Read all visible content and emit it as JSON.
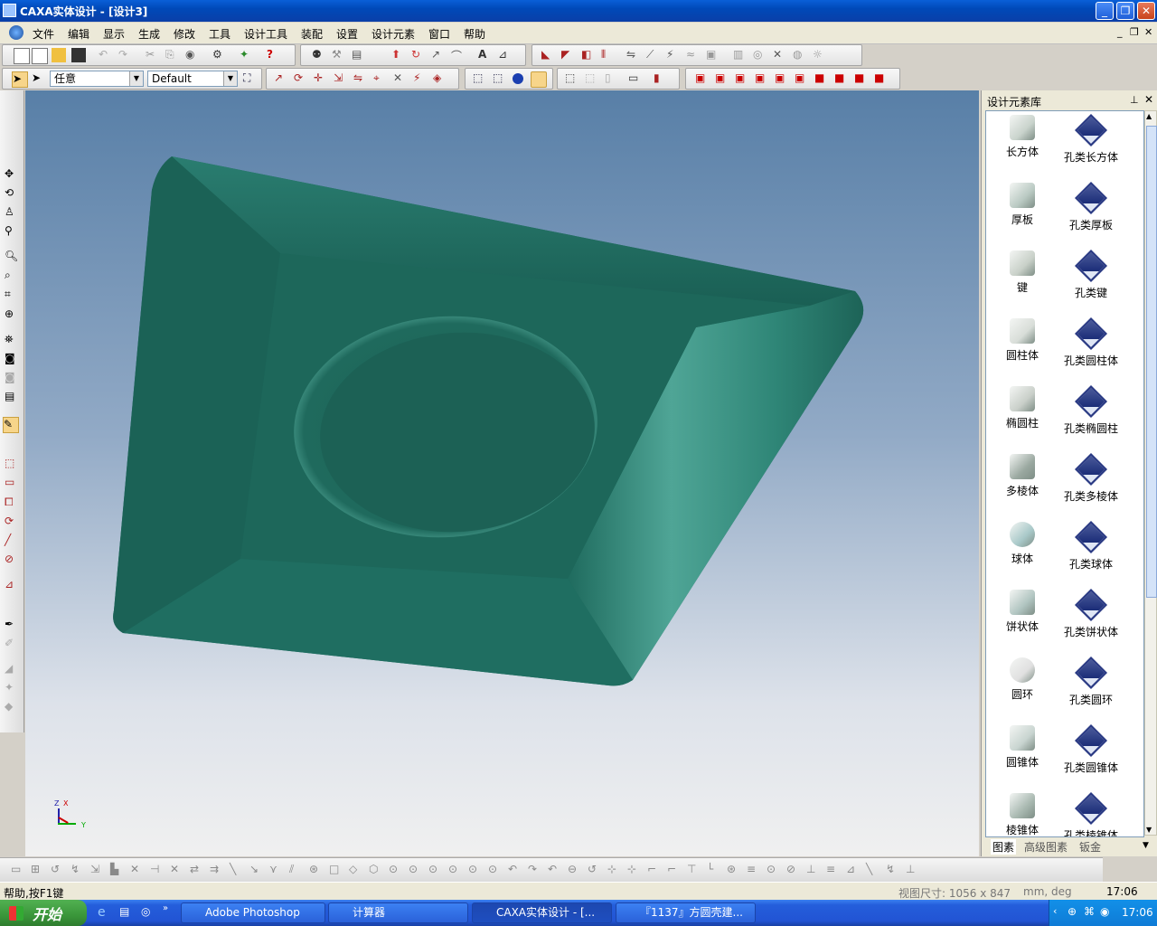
{
  "window": {
    "title": "CAXA实体设计 - [设计3]"
  },
  "menu": [
    "文件",
    "编辑",
    "显示",
    "生成",
    "修改",
    "工具",
    "设计工具",
    "装配",
    "设置",
    "设计元素",
    "窗口",
    "帮助"
  ],
  "toolbar": {
    "select_mode": "任意",
    "style": "Default"
  },
  "panel": {
    "title": "设计元素库",
    "items": [
      {
        "label": "长方体",
        "hole_label": "孔类长方体"
      },
      {
        "label": "厚板",
        "hole_label": "孔类厚板"
      },
      {
        "label": "键",
        "hole_label": "孔类键"
      },
      {
        "label": "圆柱体",
        "hole_label": "孔类圆柱体"
      },
      {
        "label": "椭圆柱",
        "hole_label": "孔类椭圆柱"
      },
      {
        "label": "多棱体",
        "hole_label": "孔类多棱体"
      },
      {
        "label": "球体",
        "hole_label": "孔类球体"
      },
      {
        "label": "饼状体",
        "hole_label": "孔类饼状体"
      },
      {
        "label": "圆环",
        "hole_label": "孔类圆环"
      },
      {
        "label": "圆锥体",
        "hole_label": "孔类圆锥体"
      },
      {
        "label": "棱锥体",
        "hole_label": "孔类棱锥体"
      }
    ],
    "tabs": [
      "图素",
      "高级图素",
      "钣金"
    ]
  },
  "axes": {
    "z": "Z",
    "x": "X",
    "y": "Y"
  },
  "status": {
    "help": "帮助,按F1键",
    "view_size": "视图尺寸: 1056 x 847",
    "units": "mm, deg",
    "time": "17:06"
  },
  "taskbar": {
    "start": "开始",
    "tasks": [
      "Adobe Photoshop",
      "计算器",
      "CAXA实体设计 - [...",
      "『1137』方圆壳建..."
    ],
    "clock": "17:06"
  },
  "colors": {
    "model": "#1f6b5e",
    "accent": "#0a5fd8"
  }
}
